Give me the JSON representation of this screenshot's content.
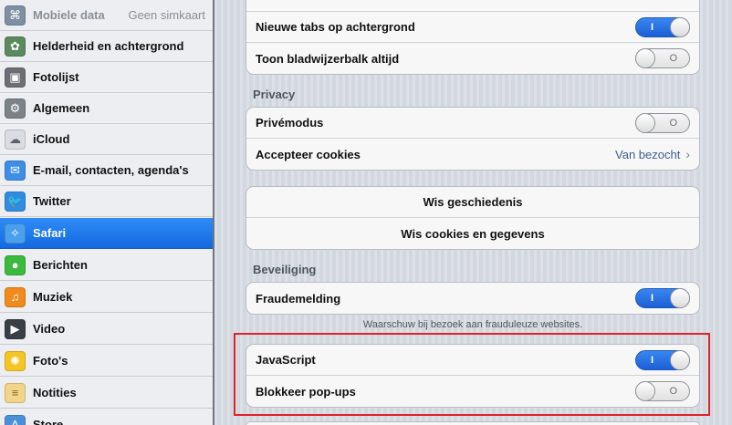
{
  "sidebar": {
    "items": [
      {
        "label": "Mobiele data",
        "value": "Geen simkaart",
        "icon": "antenna-icon",
        "color": "#7f8fa3"
      },
      {
        "label": "Helderheid en achtergrond",
        "icon": "flower-icon",
        "color": "#5a8a5e"
      },
      {
        "label": "Fotolijst",
        "icon": "picture-frame-icon",
        "color": "#6b6f75"
      },
      {
        "label": "Algemeen",
        "icon": "gear-icon",
        "color": "#7d8289"
      },
      {
        "label": "iCloud",
        "icon": "cloud-icon",
        "color": "#d9dde2"
      },
      {
        "label": "E-mail, contacten, agenda's",
        "icon": "mail-icon",
        "color": "#3e8ee6"
      },
      {
        "label": "Twitter",
        "icon": "bird-icon",
        "color": "#2f8ce0"
      },
      {
        "label": "Safari",
        "icon": "compass-icon",
        "color": "#4aa0ec"
      },
      {
        "label": "Berichten",
        "icon": "speech-bubble-icon",
        "color": "#3cba3c"
      },
      {
        "label": "Muziek",
        "icon": "music-note-icon",
        "color": "#f08a1c"
      },
      {
        "label": "Video",
        "icon": "clapperboard-icon",
        "color": "#3a3f46"
      },
      {
        "label": "Foto's",
        "icon": "sunflower-icon",
        "color": "#f3c623"
      },
      {
        "label": "Notities",
        "icon": "notepad-icon",
        "color": "#f0d68a"
      },
      {
        "label": "Store",
        "icon": "store-icon",
        "color": "#4a90d9"
      }
    ]
  },
  "main": {
    "group_top": {
      "rows": [
        {
          "label": "Nieuwe tabs op achtergrond",
          "toggle": true
        },
        {
          "label": "Toon bladwijzerbalk altijd",
          "toggle": false
        }
      ]
    },
    "privacy": {
      "header": "Privacy",
      "rows": [
        {
          "label": "Privémodus",
          "toggle": false
        },
        {
          "label": "Accepteer cookies",
          "value": "Van bezocht"
        }
      ]
    },
    "actions": {
      "clear_history": "Wis geschiedenis",
      "clear_cookies": "Wis cookies en gegevens"
    },
    "security": {
      "header": "Beveiliging",
      "fraud_label": "Fraudemelding",
      "fraud_toggle": true,
      "fraud_note": "Waarschuw bij bezoek aan frauduleuze websites.",
      "javascript_label": "JavaScript",
      "javascript_toggle": true,
      "popups_label": "Blokkeer pop-ups",
      "popups_toggle": false
    },
    "toggle_on_mark": "I",
    "toggle_off_mark": "O",
    "chevron": "›"
  },
  "colors": {
    "selection": "#1f74ea",
    "highlight": "#e0222a"
  }
}
